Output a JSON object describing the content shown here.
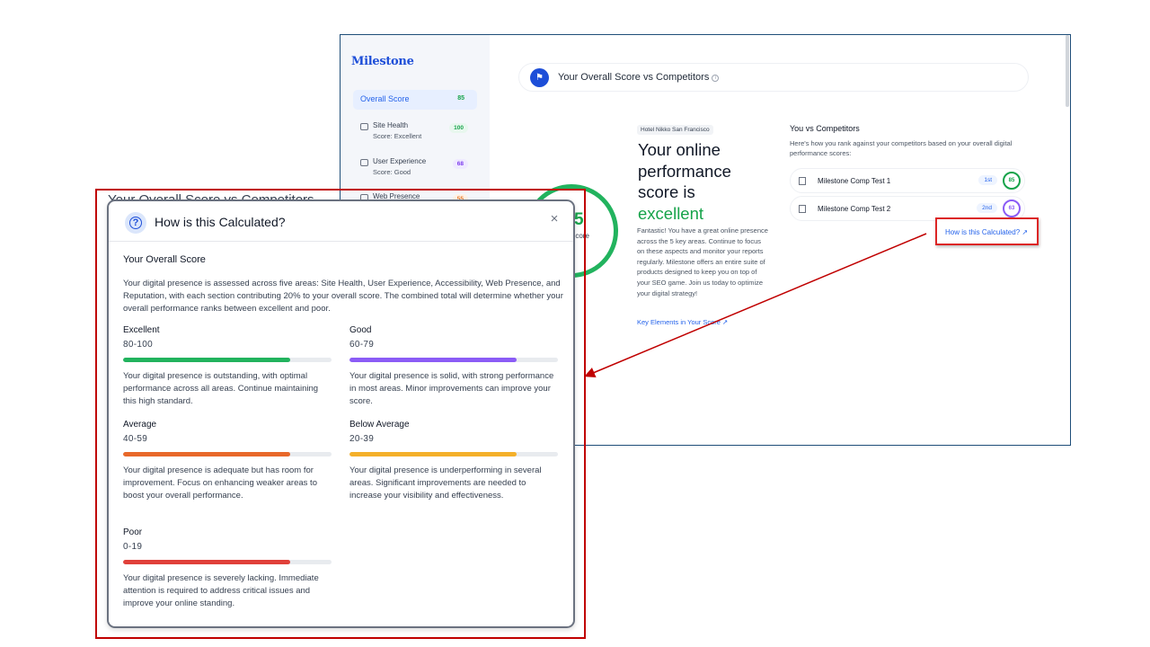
{
  "background_app": {
    "logo": "Milestone",
    "sidebar": {
      "active": {
        "label": "Overall Score",
        "value": "85"
      },
      "items": [
        {
          "label": "Site Health",
          "sub": "Score: Excellent",
          "value": "100"
        },
        {
          "label": "User Experience",
          "sub": "Score: Good",
          "value": "68"
        },
        {
          "label": "Web Presence",
          "sub": "",
          "value": "55"
        }
      ]
    },
    "header_title": "Your Overall Score vs Competitors",
    "score": {
      "partial_value": "5",
      "partial_label": "Score"
    },
    "hotel_tag": "Hotel Nikko San Francisco",
    "headline_main": "Your online performance score is",
    "headline_status": "excellent",
    "description": "Fantastic! You have a great online presence across the 5 key areas. Continue to focus on these aspects and monitor your reports regularly. Milestone offers an entire suite of products designed to keep you on top of your SEO game. Join us today to optimize your digital strategy!",
    "key_link": "Key Elements in Your Score ↗",
    "competitors": {
      "title": "You vs Competitors",
      "description": "Here's how you rank against your competitors based on your overall digital performance scores:",
      "rows": [
        {
          "name": "Milestone Comp Test 1",
          "rank": "1st",
          "score": "85",
          "color": "#16a34a"
        },
        {
          "name": "Milestone Comp Test 2",
          "rank": "2nd",
          "score": "63",
          "color": "#8b5cf6"
        }
      ],
      "calc_link": "How is this Calculated? ↗"
    }
  },
  "modal": {
    "peek_title": "Your Overall Score vs Competitors",
    "title": "How is this Calculated?",
    "close_label": "×",
    "section_title": "Your Overall Score",
    "intro": "Your digital presence is assessed across five areas: Site Health, User Experience, Accessibility, Web Presence, and Reputation, with each section contributing 20% to your overall score. The combined total will determine whether your overall performance ranks between excellent and poor.",
    "tiers": [
      {
        "name": "Excellent",
        "range": "80-100",
        "fill": 0.8,
        "color": "#22b35e",
        "text": "Your digital presence is outstanding, with optimal performance across all areas. Continue maintaining this high standard."
      },
      {
        "name": "Good",
        "range": "60-79",
        "fill": 0.8,
        "color": "#8b5cf6",
        "text": "Your digital presence is solid, with strong performance in most areas. Minor improvements can improve your score."
      },
      {
        "name": "Average",
        "range": "40-59",
        "fill": 0.8,
        "color": "#e8682a",
        "text": "Your digital presence is adequate but has room for improvement. Focus on enhancing weaker areas to boost your overall performance."
      },
      {
        "name": "Below Average",
        "range": "20-39",
        "fill": 0.8,
        "color": "#f4b02a",
        "text": "Your digital presence is underperforming in several areas. Significant improvements are needed to increase your visibility and effectiveness."
      },
      {
        "name": "Poor",
        "range": "0-19",
        "fill": 0.8,
        "color": "#e0403a",
        "text": "Your digital presence is severely lacking. Immediate attention is required to address critical issues and improve your online standing."
      }
    ]
  },
  "colors": {
    "callout": "#c00000",
    "accent": "#2563eb"
  }
}
